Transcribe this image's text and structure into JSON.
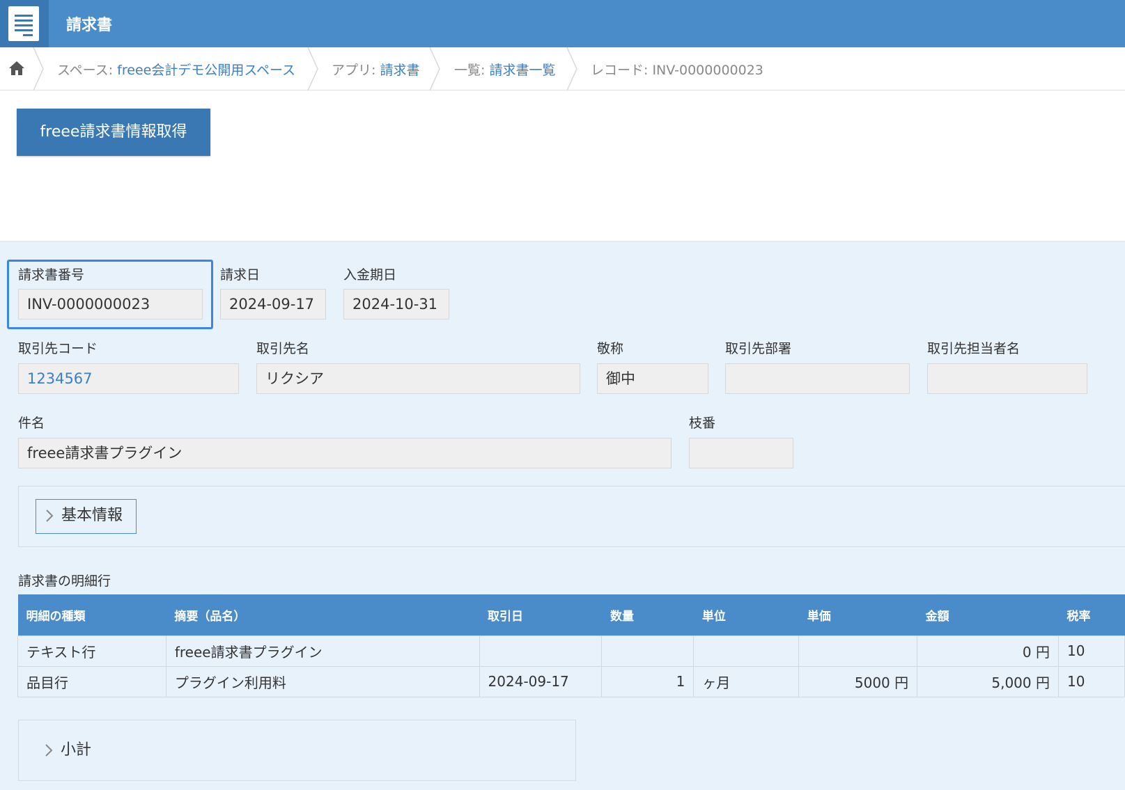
{
  "header": {
    "app_title": "請求書",
    "app_icon": "list-app-icon"
  },
  "breadcrumb": {
    "home_icon": "home-icon",
    "space_prefix": "スペース: ",
    "space_link": "freee会計デモ公開用スペース",
    "app_prefix": "アプリ: ",
    "app_link": "請求書",
    "list_prefix": "一覧: ",
    "list_link": "請求書一覧",
    "record": "レコード: INV-0000000023"
  },
  "actions": {
    "fetch_button": "freee請求書情報取得"
  },
  "fields": {
    "invoice_number": {
      "label": "請求書番号",
      "value": "INV-0000000023"
    },
    "invoice_date": {
      "label": "請求日",
      "value": "2024-09-17"
    },
    "due_date": {
      "label": "入金期日",
      "value": "2024-10-31"
    },
    "partner_code": {
      "label": "取引先コード",
      "value": "1234567"
    },
    "partner_name": {
      "label": "取引先名",
      "value": "リクシア"
    },
    "honorific": {
      "label": "敬称",
      "value": "御中"
    },
    "partner_dept": {
      "label": "取引先部署",
      "value": ""
    },
    "partner_contact": {
      "label": "取引先担当者名",
      "value": ""
    },
    "subject": {
      "label": "件名",
      "value": "freee請求書プラグイン"
    },
    "branch_no": {
      "label": "枝番",
      "value": ""
    }
  },
  "groups": {
    "basic_info": "基本情報",
    "subtotal": "小計"
  },
  "details": {
    "title": "請求書の明細行",
    "columns": [
      "明細の種類",
      "摘要（品名）",
      "取引日",
      "数量",
      "単位",
      "単価",
      "金額",
      "税率"
    ],
    "rows": [
      [
        "テキスト行",
        "freee請求書プラグイン",
        "",
        "",
        "",
        "",
        "0 円",
        "10"
      ],
      [
        "品目行",
        "プラグイン利用料",
        "2024-09-17",
        "1",
        "ヶ月",
        "5000 円",
        "5,000 円",
        "10"
      ]
    ]
  },
  "colors": {
    "header_bg": "#4a8bc9",
    "accent": "#3b86e0",
    "link": "#3b7fc4",
    "record_bg": "#e8f2fb"
  }
}
